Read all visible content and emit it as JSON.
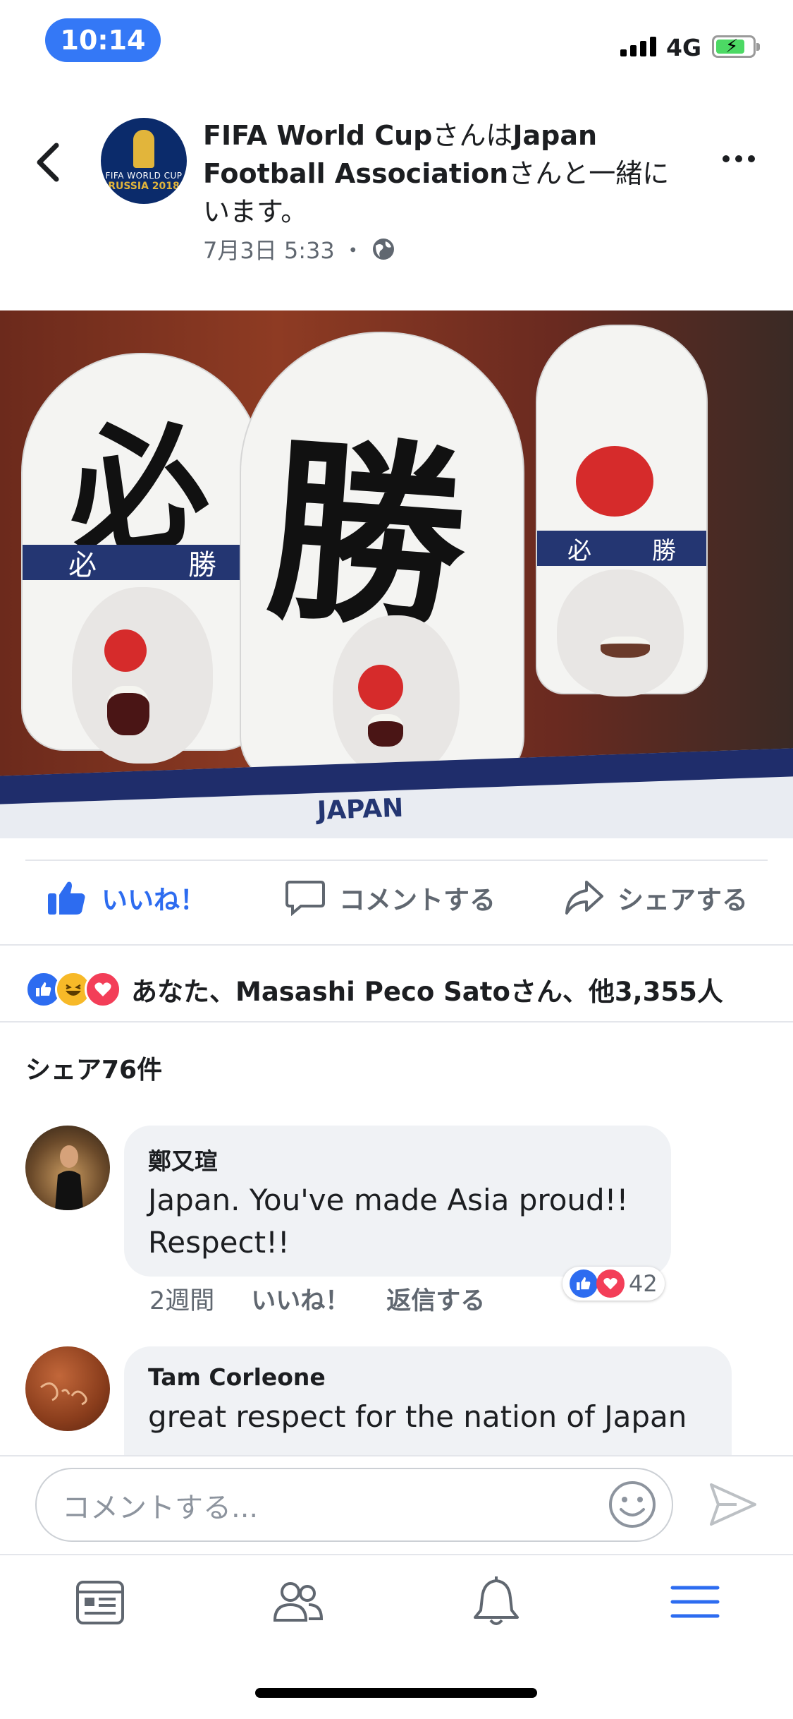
{
  "status_bar": {
    "time": "10:14",
    "network": "4G"
  },
  "post": {
    "page_name": "FIFA World Cup",
    "with_text_1": "さんは",
    "tagged_page": "Japan Football Association",
    "with_text_2": "さんと一緒にいます。",
    "date": "7月3日 5:33",
    "separator": "・",
    "avatar_line1": "FIFA WORLD CUP",
    "avatar_line2": "RUSSIA 2018",
    "photo_kanji_1": "必",
    "photo_kanji_2": "勝",
    "photo_banner_text": "JAPAN"
  },
  "actions": {
    "like": "いいね！",
    "comment": "コメントする",
    "share": "シェアする"
  },
  "reactions_summary": "あなた、Masashi Peco Satoさん、他3,355人",
  "shares_count": "シェア76件",
  "comments": [
    {
      "author": "鄭又瑄",
      "text_line1": "Japan. You've made Asia proud!!",
      "text_line2": "Respect!!",
      "time": "2週間",
      "like": "いいね！",
      "reply": "返信する",
      "reaction_count": "42"
    },
    {
      "author": "Tam Corleone",
      "text_line1": "great respect for the nation of Japan"
    }
  ],
  "comment_input": {
    "placeholder": "コメントする..."
  },
  "colors": {
    "accent": "#2d6cf0",
    "status_pill": "#3478f6",
    "love": "#f33e58",
    "haha": "#f7b928"
  },
  "tabs": [
    "news-feed-icon",
    "friends-icon",
    "notifications-icon",
    "menu-icon"
  ]
}
